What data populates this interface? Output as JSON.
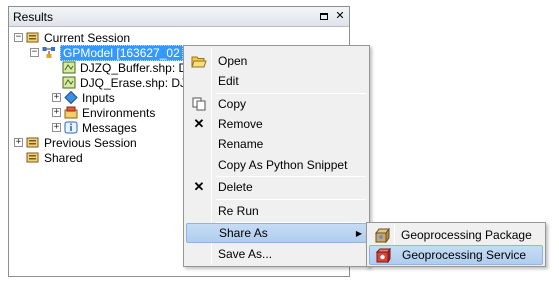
{
  "panel": {
    "title": "Results",
    "icons": [
      "maximize-icon",
      "close-icon"
    ]
  },
  "tree": {
    "current_session": "Current Session",
    "model": "GPModel [163627_02",
    "buffer": "DJZQ_Buffer.shp: D",
    "erase": "DJQ_Erase.shp: DJQ",
    "inputs": "Inputs",
    "environments": "Environments",
    "messages": "Messages",
    "previous_session": "Previous Session",
    "shared": "Shared"
  },
  "menu": {
    "open": "Open",
    "edit": "Edit",
    "copy": "Copy",
    "remove": "Remove",
    "rename": "Rename",
    "copy_python": "Copy As Python Snippet",
    "delete": "Delete",
    "rerun": "Re Run",
    "share_as": "Share As",
    "save_as": "Save As..."
  },
  "submenu": {
    "package": "Geoprocessing Package",
    "service": "Geoprocessing Service"
  },
  "colors": {
    "selection": "#3399ff",
    "menu_highlight": "#c6dcf5",
    "menu_bg": "#f0f0f0"
  }
}
